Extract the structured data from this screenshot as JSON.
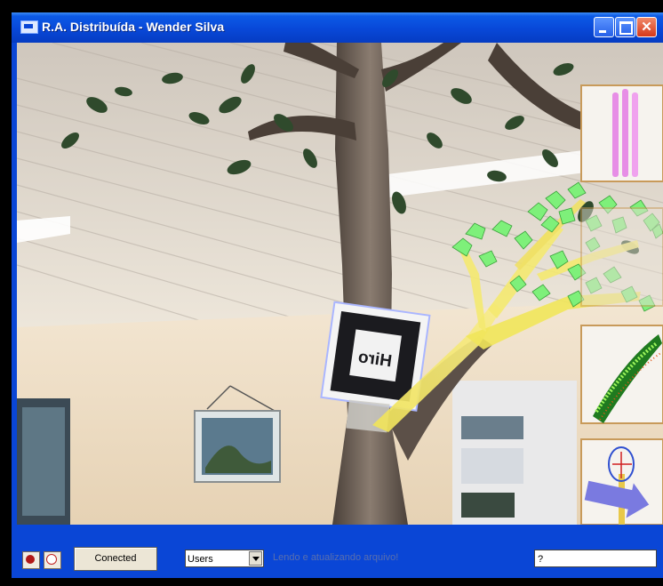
{
  "window": {
    "title": "R.A. Distribuída - Wender Silva",
    "minimize_label": "",
    "maximize_label": "",
    "close_label": "✕"
  },
  "scene": {
    "marker_text": "Hiro"
  },
  "statusbar": {
    "connect_label": "Conected",
    "users_select_value": "Users",
    "status_message": "Lendo e atualizando arquivo!",
    "question_field_value": "?",
    "alarm_icon": "alarm-clock-icon",
    "clock_icon": "clock-icon"
  },
  "colors": {
    "titlebar_blue": "#0a46d6",
    "status_text": "#5a6fae",
    "thumbnail_border": "#c89a5a",
    "tree_leaf_green": "#7ef07a",
    "branch_yellow": "#f2e84a"
  }
}
